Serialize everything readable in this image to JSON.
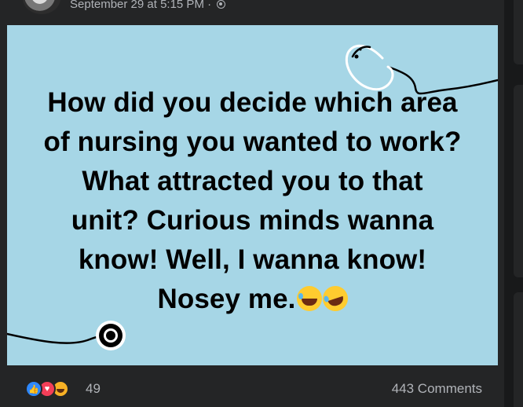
{
  "header": {
    "timestamp": "September 29 at 5:15 PM ·",
    "privacy_icon": "globe-icon"
  },
  "post": {
    "background_color": "#a6d6e6",
    "text_lines": [
      "How did you decide which area",
      "of nursing you wanted to work?",
      "What attracted you to that",
      "unit? Curious minds wanna",
      "know! Well, I wanna know!",
      "Nosey me."
    ],
    "trailing_emojis": [
      "face-with-tears-of-joy",
      "rolling-on-floor-laughing"
    ],
    "decoration": "stethoscope-illustration"
  },
  "footer": {
    "reactions": [
      "like-icon",
      "love-icon",
      "haha-icon"
    ],
    "reaction_count": "49",
    "comments_label": "443 Comments"
  },
  "colors": {
    "page_bg": "#18191a",
    "card_bg": "#242526",
    "secondary_text": "#b0b3b8"
  }
}
